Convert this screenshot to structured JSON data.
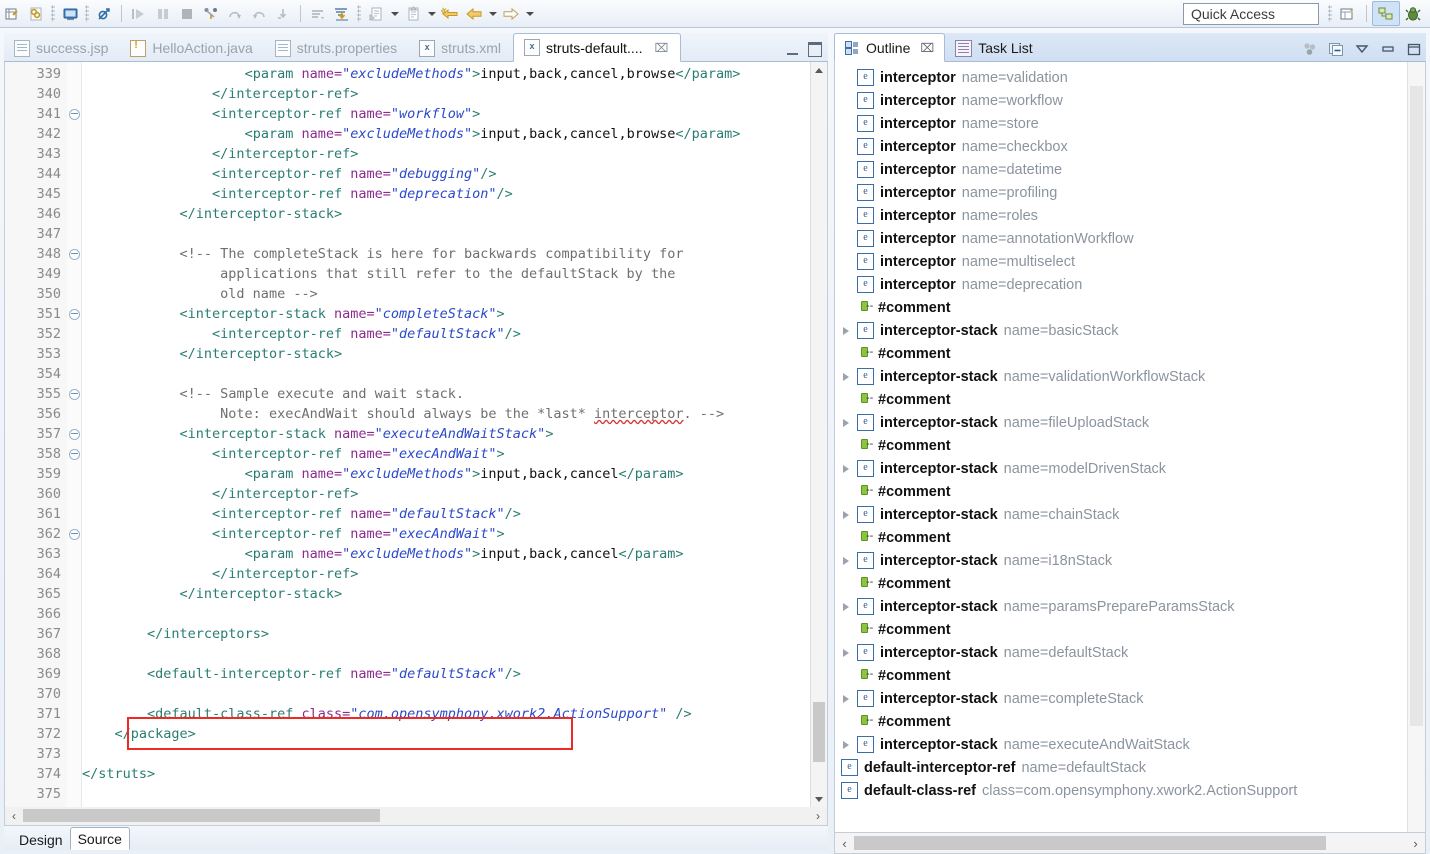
{
  "toolbar": {
    "left_icons": [
      {
        "name": "new-wizard-icon"
      },
      {
        "name": "save-icon"
      },
      {
        "name": "console-icon"
      },
      {
        "name": "skip-breakpoints-icon"
      },
      {
        "name": "run-icon"
      },
      {
        "name": "suspend-icon"
      },
      {
        "name": "terminate-icon"
      },
      {
        "name": "step-into-icon"
      },
      {
        "name": "step-over-icon"
      },
      {
        "name": "step-return-icon"
      },
      {
        "name": "drop-to-frame-icon"
      },
      {
        "name": "use-step-filters-icon"
      },
      {
        "name": "toggle-step-filters-icon"
      },
      {
        "name": "external-tools-icon"
      },
      {
        "name": "open-type-icon"
      },
      {
        "name": "previous-annotation-icon"
      },
      {
        "name": "back-icon"
      },
      {
        "name": "forward-icon"
      }
    ],
    "quick_access_placeholder": "Quick Access",
    "perspective_buttons": [
      {
        "name": "new-perspective-icon",
        "selected": false
      },
      {
        "name": "java-ee-perspective-icon",
        "selected": true
      },
      {
        "name": "debug-perspective-icon",
        "selected": false
      }
    ]
  },
  "editor": {
    "tabs": [
      {
        "label": "success.jsp",
        "icon": "jsp-file-icon",
        "icon_kind": "doc",
        "active": false,
        "closable": false
      },
      {
        "label": "HelloAction.java",
        "icon": "java-file-warning-icon",
        "icon_kind": "java",
        "active": false,
        "closable": false
      },
      {
        "label": "struts.properties",
        "icon": "properties-file-icon",
        "icon_kind": "doc",
        "active": false,
        "closable": false
      },
      {
        "label": "struts.xml",
        "icon": "xml-file-icon",
        "icon_kind": "xml",
        "icon_text": "x",
        "active": false,
        "closable": false
      },
      {
        "label": "struts-default....",
        "icon": "xml-file-icon",
        "icon_kind": "xml",
        "icon_text": "x",
        "active": true,
        "closable": true,
        "close_label": "⌧"
      }
    ],
    "minimize_label": "minimize",
    "maximize_label": "maximize",
    "first_line_number": 339,
    "last_line_number": 375,
    "fold_lines": [
      341,
      348,
      351,
      355,
      357,
      358,
      362
    ],
    "bottom_tabs": [
      {
        "label": "Design",
        "active": false
      },
      {
        "label": "Source",
        "active": true
      }
    ],
    "code_lines": [
      [
        {
          "s": "tx",
          "t": "                    "
        },
        {
          "s": "t",
          "t": "<param "
        },
        {
          "s": "a",
          "t": "name="
        },
        {
          "s": "v",
          "t": "\"excludeMethods\""
        },
        {
          "s": "t",
          "t": ">"
        },
        {
          "s": "txt",
          "t": "input,back,cancel,browse"
        },
        {
          "s": "t",
          "t": "</param>"
        }
      ],
      [
        {
          "s": "tx",
          "t": "                "
        },
        {
          "s": "t",
          "t": "</interceptor-ref>"
        }
      ],
      [
        {
          "s": "tx",
          "t": "                "
        },
        {
          "s": "t",
          "t": "<interceptor-ref "
        },
        {
          "s": "a",
          "t": "name="
        },
        {
          "s": "v",
          "t": "\"workflow\""
        },
        {
          "s": "t",
          "t": ">"
        }
      ],
      [
        {
          "s": "tx",
          "t": "                    "
        },
        {
          "s": "t",
          "t": "<param "
        },
        {
          "s": "a",
          "t": "name="
        },
        {
          "s": "v",
          "t": "\"excludeMethods\""
        },
        {
          "s": "t",
          "t": ">"
        },
        {
          "s": "txt",
          "t": "input,back,cancel,browse"
        },
        {
          "s": "t",
          "t": "</param>"
        }
      ],
      [
        {
          "s": "tx",
          "t": "                "
        },
        {
          "s": "t",
          "t": "</interceptor-ref>"
        }
      ],
      [
        {
          "s": "tx",
          "t": "                "
        },
        {
          "s": "t",
          "t": "<interceptor-ref "
        },
        {
          "s": "a",
          "t": "name="
        },
        {
          "s": "v",
          "t": "\"debugging\""
        },
        {
          "s": "t",
          "t": "/>"
        }
      ],
      [
        {
          "s": "tx",
          "t": "                "
        },
        {
          "s": "t",
          "t": "<interceptor-ref "
        },
        {
          "s": "a",
          "t": "name="
        },
        {
          "s": "v",
          "t": "\"deprecation\""
        },
        {
          "s": "t",
          "t": "/>"
        }
      ],
      [
        {
          "s": "tx",
          "t": "            "
        },
        {
          "s": "t",
          "t": "</interceptor-stack>"
        }
      ],
      [],
      [
        {
          "s": "tx",
          "t": "            "
        },
        {
          "s": "cm",
          "t": "<!-- The completeStack is here for backwards compatibility for"
        }
      ],
      [
        {
          "s": "tx",
          "t": "                 "
        },
        {
          "s": "cm",
          "t": "applications that still refer to the defaultStack by the"
        }
      ],
      [
        {
          "s": "tx",
          "t": "                 "
        },
        {
          "s": "cm",
          "t": "old name -->"
        }
      ],
      [
        {
          "s": "tx",
          "t": "            "
        },
        {
          "s": "t",
          "t": "<interceptor-stack "
        },
        {
          "s": "a",
          "t": "name="
        },
        {
          "s": "v",
          "t": "\"completeStack\""
        },
        {
          "s": "t",
          "t": ">"
        }
      ],
      [
        {
          "s": "tx",
          "t": "                "
        },
        {
          "s": "t",
          "t": "<interceptor-ref "
        },
        {
          "s": "a",
          "t": "name="
        },
        {
          "s": "v",
          "t": "\"defaultStack\""
        },
        {
          "s": "t",
          "t": "/>"
        }
      ],
      [
        {
          "s": "tx",
          "t": "            "
        },
        {
          "s": "t",
          "t": "</interceptor-stack>"
        }
      ],
      [],
      [
        {
          "s": "tx",
          "t": "            "
        },
        {
          "s": "cm",
          "t": "<!-- Sample execute and wait stack."
        }
      ],
      [
        {
          "s": "tx",
          "t": "                 "
        },
        {
          "s": "cm",
          "t": "Note: execAndWait should always be the *last* "
        },
        {
          "s": "cm sq",
          "t": "interceptor"
        },
        {
          "s": "cm",
          "t": ". -->"
        }
      ],
      [
        {
          "s": "tx",
          "t": "            "
        },
        {
          "s": "t",
          "t": "<interceptor-stack "
        },
        {
          "s": "a",
          "t": "name="
        },
        {
          "s": "v",
          "t": "\"executeAndWaitStack\""
        },
        {
          "s": "t",
          "t": ">"
        }
      ],
      [
        {
          "s": "tx",
          "t": "                "
        },
        {
          "s": "t",
          "t": "<interceptor-ref "
        },
        {
          "s": "a",
          "t": "name="
        },
        {
          "s": "v",
          "t": "\"execAndWait\""
        },
        {
          "s": "t",
          "t": ">"
        }
      ],
      [
        {
          "s": "tx",
          "t": "                    "
        },
        {
          "s": "t",
          "t": "<param "
        },
        {
          "s": "a",
          "t": "name="
        },
        {
          "s": "v",
          "t": "\"excludeMethods\""
        },
        {
          "s": "t",
          "t": ">"
        },
        {
          "s": "txt",
          "t": "input,back,cancel"
        },
        {
          "s": "t",
          "t": "</param>"
        }
      ],
      [
        {
          "s": "tx",
          "t": "                "
        },
        {
          "s": "t",
          "t": "</interceptor-ref>"
        }
      ],
      [
        {
          "s": "tx",
          "t": "                "
        },
        {
          "s": "t",
          "t": "<interceptor-ref "
        },
        {
          "s": "a",
          "t": "name="
        },
        {
          "s": "v",
          "t": "\"defaultStack\""
        },
        {
          "s": "t",
          "t": "/>"
        }
      ],
      [
        {
          "s": "tx",
          "t": "                "
        },
        {
          "s": "t",
          "t": "<interceptor-ref "
        },
        {
          "s": "a",
          "t": "name="
        },
        {
          "s": "v",
          "t": "\"execAndWait\""
        },
        {
          "s": "t",
          "t": ">"
        }
      ],
      [
        {
          "s": "tx",
          "t": "                    "
        },
        {
          "s": "t",
          "t": "<param "
        },
        {
          "s": "a",
          "t": "name="
        },
        {
          "s": "v",
          "t": "\"excludeMethods\""
        },
        {
          "s": "t",
          "t": ">"
        },
        {
          "s": "txt",
          "t": "input,back,cancel"
        },
        {
          "s": "t",
          "t": "</param>"
        }
      ],
      [
        {
          "s": "tx",
          "t": "                "
        },
        {
          "s": "t",
          "t": "</interceptor-ref>"
        }
      ],
      [
        {
          "s": "tx",
          "t": "            "
        },
        {
          "s": "t",
          "t": "</interceptor-stack>"
        }
      ],
      [],
      [
        {
          "s": "tx",
          "t": "        "
        },
        {
          "s": "t",
          "t": "</interceptors>"
        }
      ],
      [],
      [
        {
          "s": "tx",
          "t": "        "
        },
        {
          "s": "t",
          "t": "<default-interceptor-ref "
        },
        {
          "s": "a",
          "t": "name="
        },
        {
          "s": "v",
          "t": "\"defaultStack\""
        },
        {
          "s": "t",
          "t": "/>"
        }
      ],
      [],
      [
        {
          "s": "tx",
          "t": "        "
        },
        {
          "s": "t",
          "t": "<default-class-ref "
        },
        {
          "s": "a",
          "t": "class="
        },
        {
          "s": "v",
          "t": "\"com.opensymphony.xwork2.ActionSupport\""
        },
        {
          "s": "t",
          "t": " />"
        }
      ],
      [
        {
          "s": "tx",
          "t": "    "
        },
        {
          "s": "t",
          "t": "</package>"
        }
      ],
      [],
      [
        {
          "s": "t",
          "t": "</struts>"
        }
      ],
      []
    ]
  },
  "outline": {
    "tabs": [
      {
        "label": "Outline",
        "icon": "outline-icon",
        "icon_kind": "outline",
        "active": true,
        "closable": true,
        "close_label": "⌧"
      },
      {
        "label": "Task List",
        "icon": "task-list-icon",
        "icon_kind": "task",
        "active": false,
        "closable": false
      }
    ],
    "toolbar_icons": [
      {
        "name": "sort-group-icon"
      },
      {
        "name": "collapse-all-icon"
      },
      {
        "name": "view-menu-icon"
      },
      {
        "name": "minimize-icon"
      },
      {
        "name": "maximize-icon"
      }
    ],
    "logo_name": "struts-hummingbird-logo",
    "highlight_color": "#ee2b22",
    "items": [
      {
        "kind": "element",
        "expandable": false,
        "name": "interceptor",
        "attr": "name=validation"
      },
      {
        "kind": "element",
        "expandable": false,
        "name": "interceptor",
        "attr": "name=workflow"
      },
      {
        "kind": "element",
        "expandable": false,
        "name": "interceptor",
        "attr": "name=store"
      },
      {
        "kind": "element",
        "expandable": false,
        "name": "interceptor",
        "attr": "name=checkbox"
      },
      {
        "kind": "element",
        "expandable": false,
        "name": "interceptor",
        "attr": "name=datetime"
      },
      {
        "kind": "element",
        "expandable": false,
        "name": "interceptor",
        "attr": "name=profiling"
      },
      {
        "kind": "element",
        "expandable": false,
        "name": "interceptor",
        "attr": "name=roles"
      },
      {
        "kind": "element",
        "expandable": false,
        "name": "interceptor",
        "attr": "name=annotationWorkflow"
      },
      {
        "kind": "element",
        "expandable": false,
        "name": "interceptor",
        "attr": "name=multiselect"
      },
      {
        "kind": "element",
        "expandable": false,
        "name": "interceptor",
        "attr": "name=deprecation"
      },
      {
        "kind": "comment",
        "expandable": false,
        "name": "#comment",
        "attr": ""
      },
      {
        "kind": "element",
        "expandable": true,
        "name": "interceptor-stack",
        "attr": "name=basicStack"
      },
      {
        "kind": "comment",
        "expandable": false,
        "name": "#comment",
        "attr": ""
      },
      {
        "kind": "element",
        "expandable": true,
        "name": "interceptor-stack",
        "attr": "name=validationWorkflowStack"
      },
      {
        "kind": "comment",
        "expandable": false,
        "name": "#comment",
        "attr": ""
      },
      {
        "kind": "element",
        "expandable": true,
        "name": "interceptor-stack",
        "attr": "name=fileUploadStack"
      },
      {
        "kind": "comment",
        "expandable": false,
        "name": "#comment",
        "attr": ""
      },
      {
        "kind": "element",
        "expandable": true,
        "name": "interceptor-stack",
        "attr": "name=modelDrivenStack"
      },
      {
        "kind": "comment",
        "expandable": false,
        "name": "#comment",
        "attr": ""
      },
      {
        "kind": "element",
        "expandable": true,
        "name": "interceptor-stack",
        "attr": "name=chainStack"
      },
      {
        "kind": "comment",
        "expandable": false,
        "name": "#comment",
        "attr": ""
      },
      {
        "kind": "element",
        "expandable": true,
        "name": "interceptor-stack",
        "attr": "name=i18nStack"
      },
      {
        "kind": "comment",
        "expandable": false,
        "name": "#comment",
        "attr": ""
      },
      {
        "kind": "element",
        "expandable": true,
        "name": "interceptor-stack",
        "attr": "name=paramsPrepareParamsStack"
      },
      {
        "kind": "comment",
        "expandable": false,
        "name": "#comment",
        "attr": ""
      },
      {
        "kind": "element",
        "expandable": true,
        "name": "interceptor-stack",
        "attr": "name=defaultStack",
        "highlighted": true
      },
      {
        "kind": "comment",
        "expandable": false,
        "name": "#comment",
        "attr": ""
      },
      {
        "kind": "element",
        "expandable": true,
        "name": "interceptor-stack",
        "attr": "name=completeStack"
      },
      {
        "kind": "comment",
        "expandable": false,
        "name": "#comment",
        "attr": ""
      },
      {
        "kind": "element",
        "expandable": true,
        "name": "interceptor-stack",
        "attr": "name=executeAndWaitStack"
      },
      {
        "kind": "element",
        "expandable": false,
        "name": "default-interceptor-ref",
        "attr": "name=defaultStack",
        "root": true
      },
      {
        "kind": "element",
        "expandable": false,
        "name": "default-class-ref",
        "attr": "class=com.opensymphony.xwork2.ActionSupport",
        "root": true
      }
    ]
  },
  "scrollbars": {
    "left_arrow": "‹",
    "right_arrow": "›"
  }
}
